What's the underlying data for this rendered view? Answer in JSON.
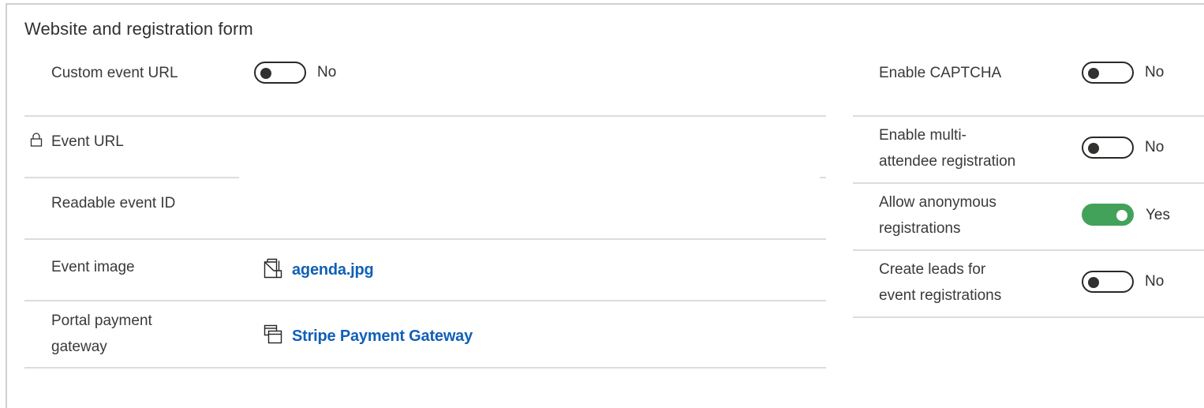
{
  "section": {
    "title": "Website and registration form"
  },
  "left_fields": {
    "custom_event_url": {
      "label": "Custom event URL",
      "value": false,
      "value_text": "No"
    },
    "event_url": {
      "label": "Event URL",
      "locked": true,
      "icon": "lock-icon",
      "value": ""
    },
    "readable_event_id": {
      "label": "Readable event ID",
      "value": ""
    },
    "event_image": {
      "label": "Event image",
      "value": "agenda.jpg",
      "icon": "image-entity-icon"
    },
    "portal_payment_gateway": {
      "label_line1": "Portal payment",
      "label_line2": "gateway",
      "value": "Stripe Payment Gateway",
      "icon": "record-entity-icon"
    }
  },
  "right_fields": {
    "enable_captcha": {
      "label": "Enable CAPTCHA",
      "value": false,
      "value_text": "No"
    },
    "enable_multi_attendee": {
      "label_line1": "Enable multi-",
      "label_line2": "attendee registration",
      "value": false,
      "value_text": "No"
    },
    "allow_anonymous": {
      "label_line1": "Allow anonymous",
      "label_line2": "registrations",
      "value": true,
      "value_text": "Yes"
    },
    "create_leads": {
      "label_line1": "Create leads for",
      "label_line2": "event registrations",
      "value": false,
      "value_text": "No"
    }
  },
  "colors": {
    "link": "#1160b7",
    "toggle_on": "#43a25a",
    "toggle_off_border": "#292827",
    "divider": "#dcdcdc"
  }
}
